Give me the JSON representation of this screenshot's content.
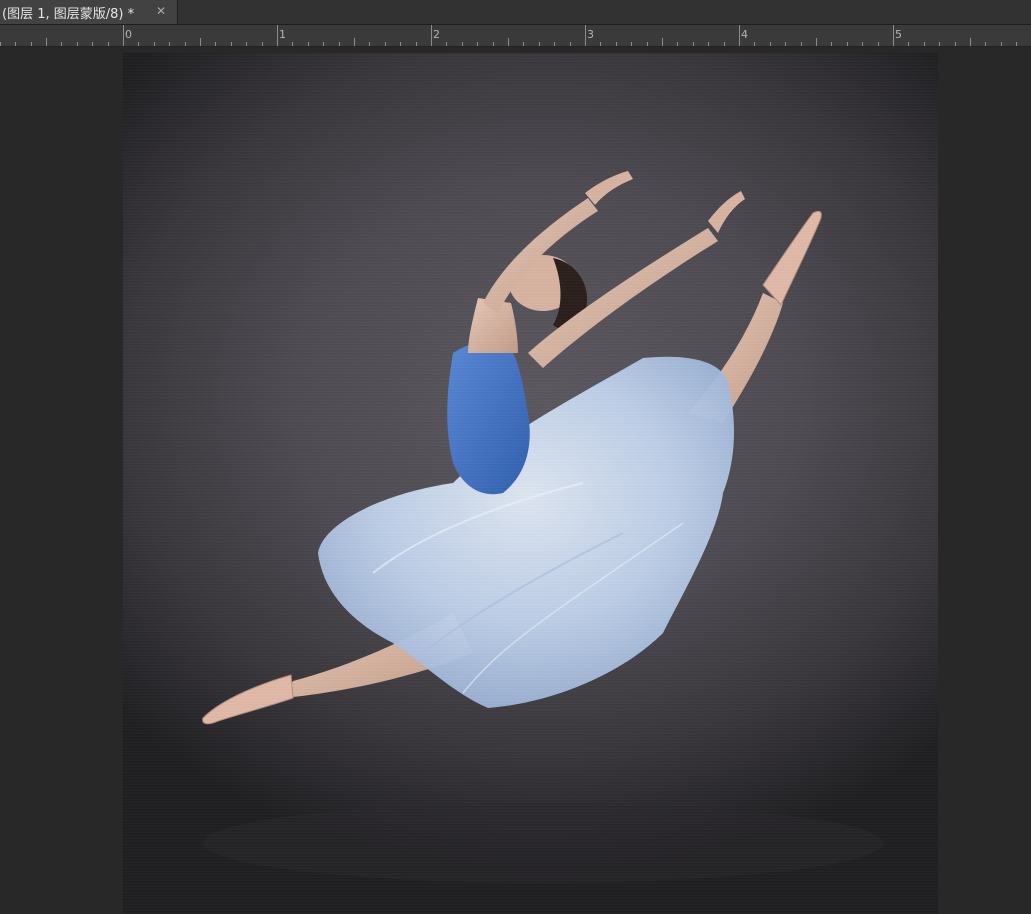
{
  "document_tab": {
    "title": "(图层 1, 图层蒙版/8) *",
    "close_icon": "close-icon"
  },
  "ruler": {
    "labels": [
      "0",
      "1",
      "2",
      "3",
      "4",
      "5"
    ]
  },
  "canvas": {
    "subject": "ballerina-leap-photo",
    "colors": {
      "background": "#4d4a51",
      "leotard": "#4a78c8",
      "tutu": "#c7d8ef",
      "skin": "#d9b8a8"
    }
  }
}
